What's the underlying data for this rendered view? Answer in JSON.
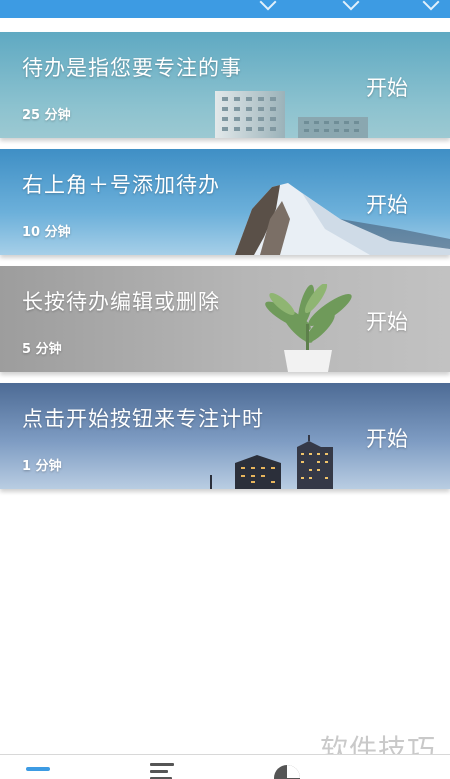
{
  "todos": [
    {
      "title": "待办是指您要专注的事",
      "duration": "25 分钟",
      "start_label": "开始"
    },
    {
      "title": "右上角＋号添加待办",
      "duration": "10 分钟",
      "start_label": "开始"
    },
    {
      "title": "长按待办编辑或删除",
      "duration": "5 分钟",
      "start_label": "开始"
    },
    {
      "title": "点击开始按钮来专注计时",
      "duration": "1 分钟",
      "start_label": "开始"
    }
  ],
  "bottom_nav": {
    "tabs": [
      {
        "icon": "timer-tab-icon",
        "active": true
      },
      {
        "icon": "list-tab-icon",
        "active": false
      },
      {
        "icon": "pie-chart-icon",
        "active": false
      }
    ]
  },
  "watermark": "软件技巧",
  "colors": {
    "accent": "#3d9be3",
    "card_text": "#ffffff"
  }
}
